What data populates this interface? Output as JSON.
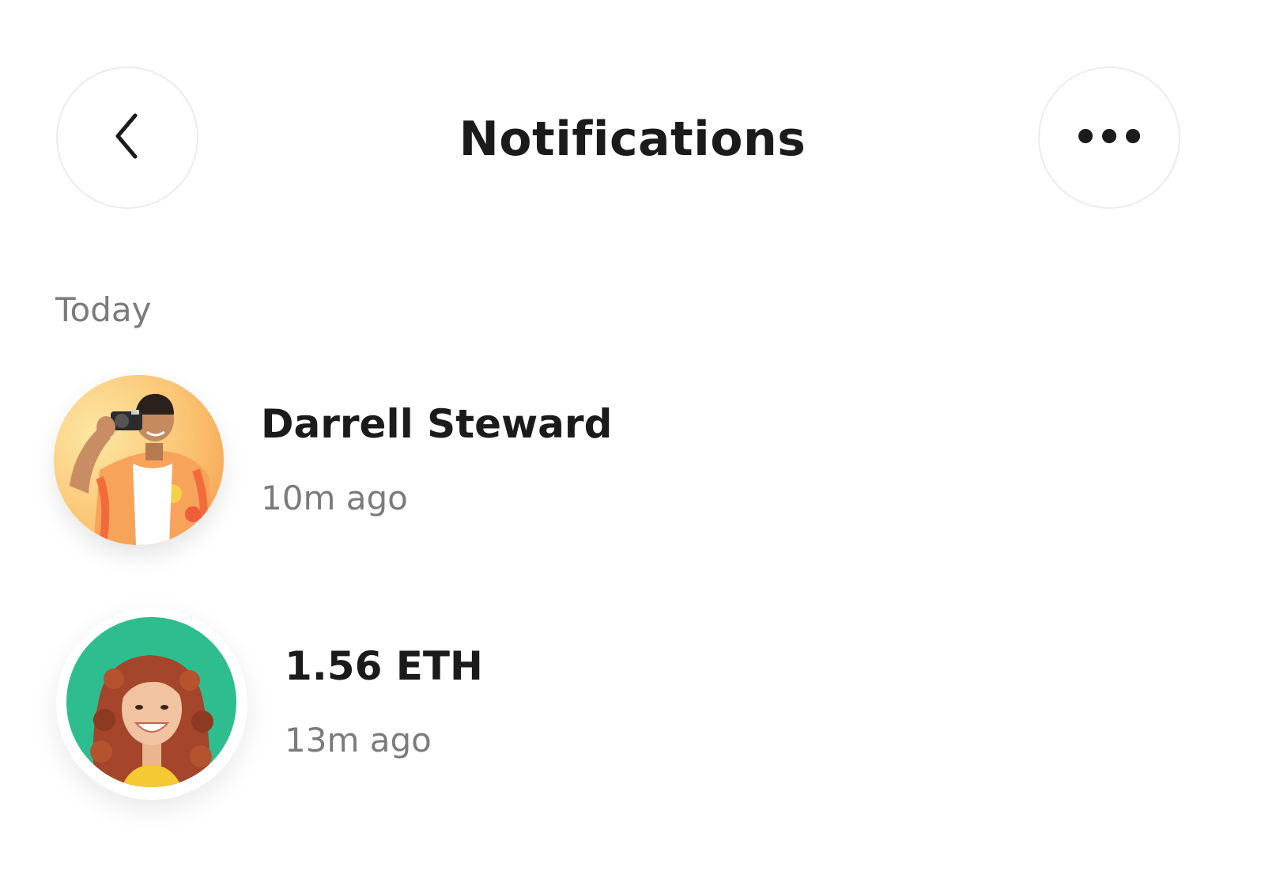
{
  "header": {
    "title": "Notifications",
    "back_icon": "chevron-left-icon",
    "more_icon": "more-horizontal-icon"
  },
  "sections": [
    {
      "label": "Today",
      "items": [
        {
          "title": "Darrell Steward",
          "time": "10m ago",
          "avatar_bg": "#f6b45c"
        },
        {
          "title": "1.56 ETH",
          "time": "13m ago",
          "avatar_bg": "#2ebd8f"
        }
      ]
    }
  ]
}
